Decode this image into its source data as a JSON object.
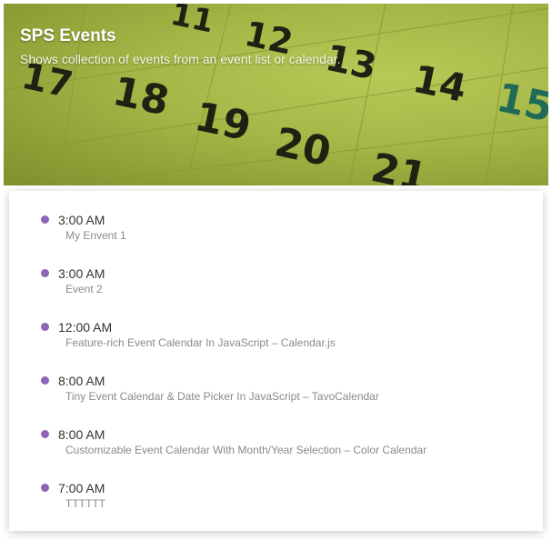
{
  "header": {
    "title": "SPS Events",
    "subtitle": "Shows collection of events from an event list or calendar.",
    "calendar_numbers": [
      "11",
      "12",
      "13",
      "14",
      "15",
      "17",
      "18",
      "19",
      "20",
      "21"
    ]
  },
  "events": [
    {
      "time": "3:00 AM",
      "title": "My Envent 1"
    },
    {
      "time": "3:00 AM",
      "title": "Event 2"
    },
    {
      "time": "12:00 AM",
      "title": "Feature-rich Event Calendar In JavaScript – Calendar.js"
    },
    {
      "time": "8:00 AM",
      "title": "Tiny Event Calendar & Date Picker In JavaScript – TavoCalendar"
    },
    {
      "time": "8:00 AM",
      "title": "Customizable Event Calendar With Month/Year Selection – Color Calendar"
    },
    {
      "time": "7:00 AM",
      "title": "TTTTTT"
    }
  ],
  "colors": {
    "dot": "#8e63b8",
    "hero_green": "#a4b646",
    "weekend_number": "#1f6b57"
  }
}
